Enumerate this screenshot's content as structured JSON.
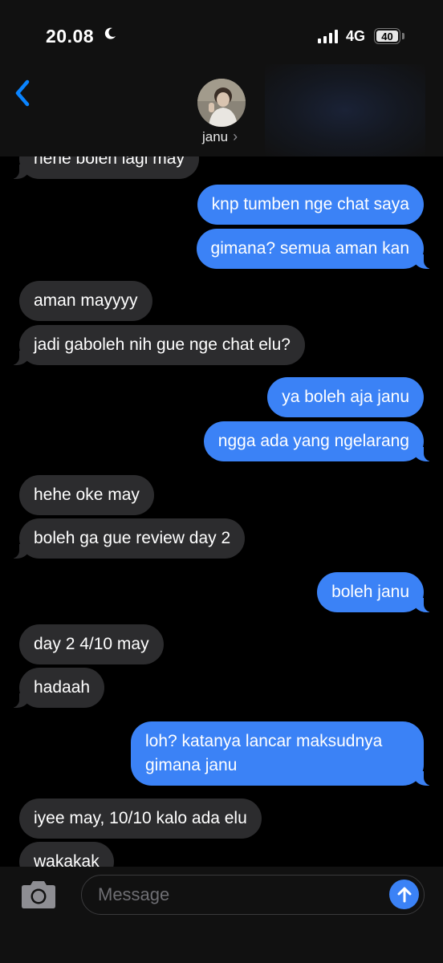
{
  "status_bar": {
    "time": "20.08",
    "network": "4G",
    "battery": "40"
  },
  "header": {
    "contact_name": "janu"
  },
  "messages": [
    {
      "side": "in",
      "text": "hehe boleh lagi may"
    },
    {
      "side": "out",
      "text": "knp tumben nge chat saya"
    },
    {
      "side": "out",
      "text": "gimana? semua aman kan"
    },
    {
      "side": "in",
      "text": "aman mayyyy"
    },
    {
      "side": "in",
      "text": "jadi gaboleh nih gue nge chat elu?"
    },
    {
      "side": "out",
      "text": "ya boleh aja janu"
    },
    {
      "side": "out",
      "text": "ngga ada yang ngelarang"
    },
    {
      "side": "in",
      "text": "hehe oke may"
    },
    {
      "side": "in",
      "text": "boleh ga gue review day 2"
    },
    {
      "side": "out",
      "text": "boleh janu"
    },
    {
      "side": "in",
      "text": "day 2 4/10 may"
    },
    {
      "side": "in",
      "text": "hadaah"
    },
    {
      "side": "out",
      "text": "loh? katanya lancar maksudnya gimana janu"
    },
    {
      "side": "in",
      "text": "iyee may, 10/10 kalo ada elu"
    },
    {
      "side": "in",
      "text": "wakakak"
    }
  ],
  "input": {
    "placeholder": "Message"
  },
  "colors": {
    "outgoing": "#3b82f6",
    "incoming": "#2c2c2e",
    "accent": "#0a84ff"
  }
}
